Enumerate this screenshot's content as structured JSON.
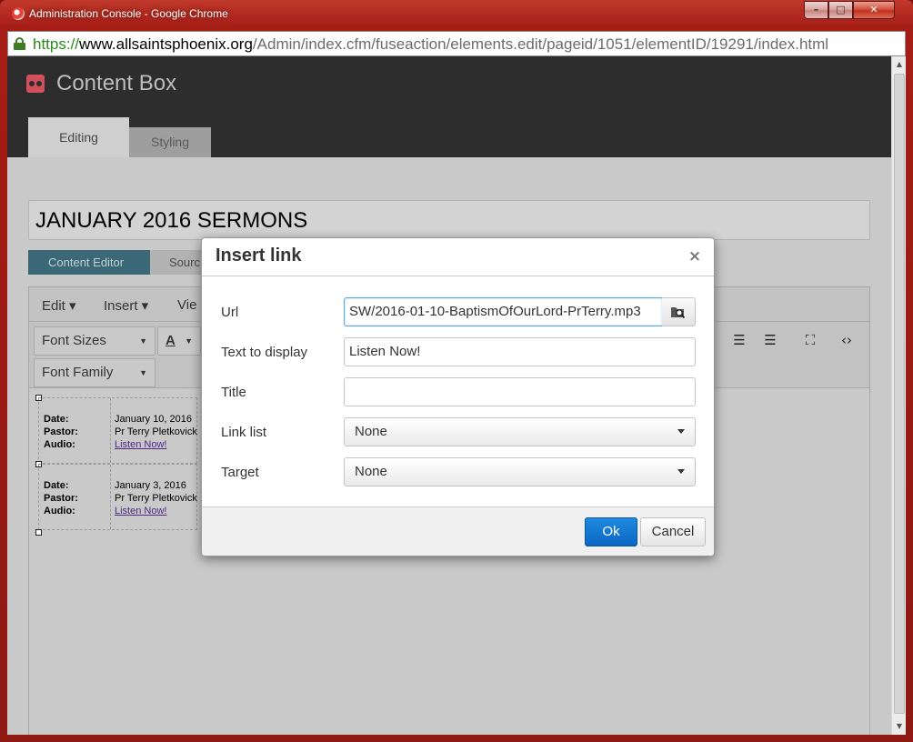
{
  "window": {
    "title": "Administration Console - Google Chrome"
  },
  "browser": {
    "url_scheme": "https://",
    "url_host": "www.allsaintsphoenix.org",
    "url_path": "/Admin/index.cfm/fuseaction/elements.edit/pageid/1051/elementID/19291/index.html"
  },
  "app": {
    "title": "Content Box",
    "tabs": {
      "editing": "Editing",
      "styling": "Styling"
    },
    "page_title": "JANUARY 2016 SERMONS",
    "modes": {
      "content_editor": "Content Editor",
      "source": "Sourc"
    }
  },
  "editor": {
    "menus": {
      "edit": "Edit",
      "insert": "Insert",
      "view": "Vie"
    },
    "toolbar": {
      "font_sizes": "Font Sizes",
      "font_family": "Font Family",
      "text_color": "A"
    },
    "entries": [
      {
        "date_label": "Date:",
        "date": "January 10, 2016",
        "pastor_label": "Pastor:",
        "pastor": "Pr Terry Pletkovick",
        "audio_label": "Audio:",
        "audio": "Listen Now!"
      },
      {
        "date_label": "Date:",
        "date": "January 3, 2016",
        "pastor_label": "Pastor:",
        "pastor": "Pr Terry Pletkovick",
        "audio_label": "Audio:",
        "audio": "Listen Now!"
      }
    ]
  },
  "dialog": {
    "title": "Insert link",
    "close": "×",
    "fields": {
      "url_label": "Url",
      "url_value": "SW/2016-01-10-BaptismOfOurLord-PrTerry.mp3",
      "text_label": "Text to display",
      "text_value": "Listen Now!",
      "title_label": "Title",
      "title_value": "",
      "link_list_label": "Link list",
      "link_list_value": "None",
      "target_label": "Target",
      "target_value": "None"
    },
    "buttons": {
      "ok": "Ok",
      "cancel": "Cancel"
    }
  },
  "colors": {
    "accent": "#3b6876",
    "primary_button": "#0a66c4",
    "logo": "#d2505b",
    "header_bg": "#2d2d2d"
  }
}
